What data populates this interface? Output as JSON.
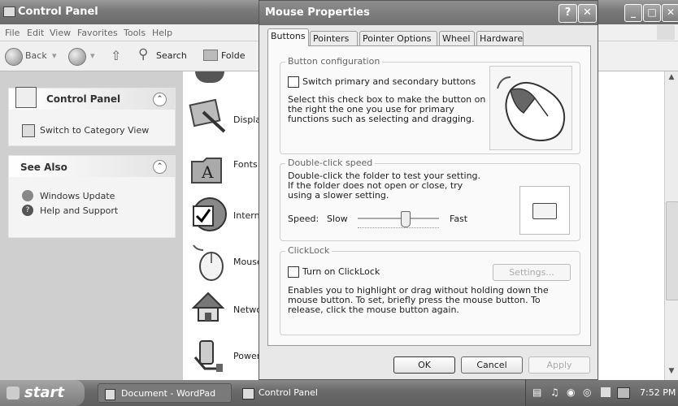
{
  "control_panel": {
    "title": "Control Panel",
    "menu": [
      "File",
      "Edit",
      "View",
      "Favorites",
      "Tools",
      "Help"
    ],
    "toolbar": {
      "back": "Back",
      "search": "Search",
      "folders": "Folde"
    },
    "sidebar": {
      "panel_title": "Control Panel",
      "switch_view": "Switch to Category View",
      "see_also_title": "See Also",
      "see_also_items": [
        "Windows Update",
        "Help and Support"
      ]
    },
    "items": [
      "Displa",
      "Fonts",
      "Intern",
      "Mouse",
      "Netwo",
      "Power"
    ]
  },
  "dialog": {
    "title": "Mouse Properties",
    "tabs": [
      "Buttons",
      "Pointers",
      "Pointer Options",
      "Wheel",
      "Hardware"
    ],
    "active_tab": "Buttons",
    "button_config": {
      "legend": "Button configuration",
      "checkbox_label": "Switch primary and secondary buttons",
      "checked": false,
      "description": "Select this check box to make the button on the right the one you use for primary functions such as selecting and dragging."
    },
    "double_click": {
      "legend": "Double-click speed",
      "description": "Double-click the folder to test your setting. If the folder does not open or close, try using a slower setting.",
      "speed_label": "Speed:",
      "slow": "Slow",
      "fast": "Fast",
      "slider_fraction": 0.6
    },
    "clicklock": {
      "legend": "ClickLock",
      "checkbox_label": "Turn on ClickLock",
      "checked": false,
      "settings_button": "Settings...",
      "description": "Enables you to highlight or drag without holding down the mouse button. To set, briefly press the mouse button. To release, click the mouse button again."
    },
    "buttons": {
      "ok": "OK",
      "cancel": "Cancel",
      "apply": "Apply"
    }
  },
  "taskbar": {
    "start": "start",
    "tasks": [
      "Document - WordPad",
      "Control Panel"
    ],
    "clock": "7:52 PM"
  }
}
